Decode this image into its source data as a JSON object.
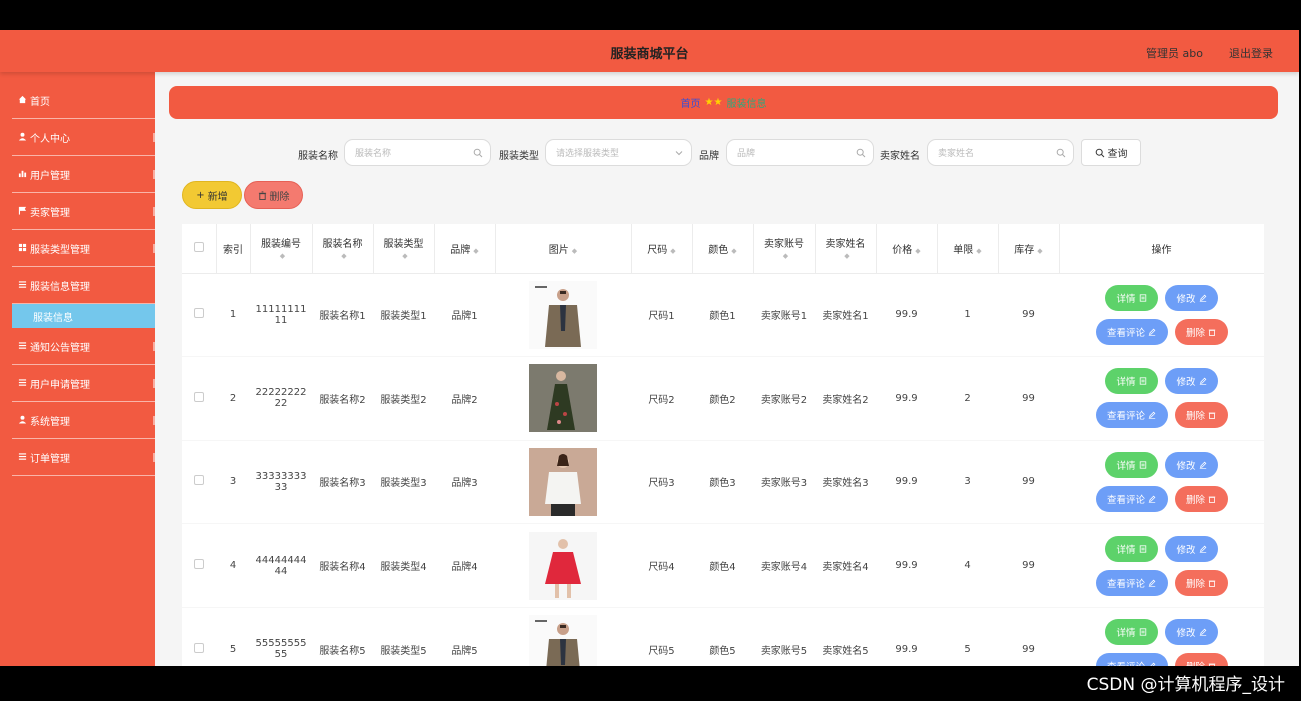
{
  "header": {
    "title": "服装商城平台",
    "user": "管理员 abo",
    "logout": "退出登录"
  },
  "sidebar": {
    "items": [
      {
        "label": "首页",
        "icon": "home-icon"
      },
      {
        "label": "个人中心",
        "icon": "user-icon"
      },
      {
        "label": "用户管理",
        "icon": "bar-chart-icon"
      },
      {
        "label": "卖家管理",
        "icon": "flag-icon"
      },
      {
        "label": "服装类型管理",
        "icon": "grid-icon"
      },
      {
        "label": "服装信息管理",
        "icon": "list-icon"
      }
    ],
    "sub_active": "服装信息",
    "items_after": [
      {
        "label": "通知公告管理",
        "icon": "list-icon"
      },
      {
        "label": "用户申请管理",
        "icon": "list-icon"
      },
      {
        "label": "系统管理",
        "icon": "user-icon"
      },
      {
        "label": "订单管理",
        "icon": "list-icon"
      }
    ]
  },
  "breadcrumb": {
    "home": "首页",
    "current": "服装信息",
    "separator": "★★"
  },
  "search": {
    "name_label": "服装名称",
    "name_placeholder": "服装名称",
    "type_label": "服装类型",
    "type_placeholder": "请选择服装类型",
    "brand_label": "品牌",
    "brand_placeholder": "品牌",
    "seller_label": "卖家姓名",
    "seller_placeholder": "卖家姓名",
    "query": "查询"
  },
  "actions": {
    "add": "新增",
    "delete": "删除"
  },
  "table": {
    "headers": [
      "索引",
      "服装编号",
      "服装名称",
      "服装类型",
      "品牌",
      "图片",
      "尺码",
      "颜色",
      "卖家账号",
      "卖家姓名",
      "价格",
      "单限",
      "库存",
      "操作"
    ],
    "rows": [
      {
        "index": "1",
        "code_a": "11111111",
        "code_b": "11",
        "name": "服装名称1",
        "type": "服装类型1",
        "brand": "品牌1",
        "size": "尺码1",
        "color": "颜色1",
        "seller_acc": "卖家账号1",
        "seller_name": "卖家姓名1",
        "price": "99.9",
        "limit": "1",
        "stock": "99"
      },
      {
        "index": "2",
        "code_a": "22222222",
        "code_b": "22",
        "name": "服装名称2",
        "type": "服装类型2",
        "brand": "品牌2",
        "size": "尺码2",
        "color": "颜色2",
        "seller_acc": "卖家账号2",
        "seller_name": "卖家姓名2",
        "price": "99.9",
        "limit": "2",
        "stock": "99"
      },
      {
        "index": "3",
        "code_a": "33333333",
        "code_b": "33",
        "name": "服装名称3",
        "type": "服装类型3",
        "brand": "品牌3",
        "size": "尺码3",
        "color": "颜色3",
        "seller_acc": "卖家账号3",
        "seller_name": "卖家姓名3",
        "price": "99.9",
        "limit": "3",
        "stock": "99"
      },
      {
        "index": "4",
        "code_a": "44444444",
        "code_b": "44",
        "name": "服装名称4",
        "type": "服装类型4",
        "brand": "品牌4",
        "size": "尺码4",
        "color": "颜色4",
        "seller_acc": "卖家账号4",
        "seller_name": "卖家姓名4",
        "price": "99.9",
        "limit": "4",
        "stock": "99"
      },
      {
        "index": "5",
        "code_a": "55555555",
        "code_b": "55",
        "name": "服装名称5",
        "type": "服装类型5",
        "brand": "品牌5",
        "size": "尺码5",
        "color": "颜色5",
        "seller_acc": "卖家账号5",
        "seller_name": "卖家姓名5",
        "price": "99.9",
        "limit": "5",
        "stock": "99"
      }
    ],
    "op_labels": {
      "detail": "详情",
      "edit": "修改",
      "review": "查看评论",
      "delete": "删除"
    }
  },
  "watermark": "CSDN @计算机程序_设计",
  "colors": {
    "primary": "#f25a41",
    "active_sub": "#74c7ec",
    "detail": "#5dd26a",
    "edit": "#6d9ef7",
    "delete": "#f46e5c",
    "add": "#f2c933"
  }
}
